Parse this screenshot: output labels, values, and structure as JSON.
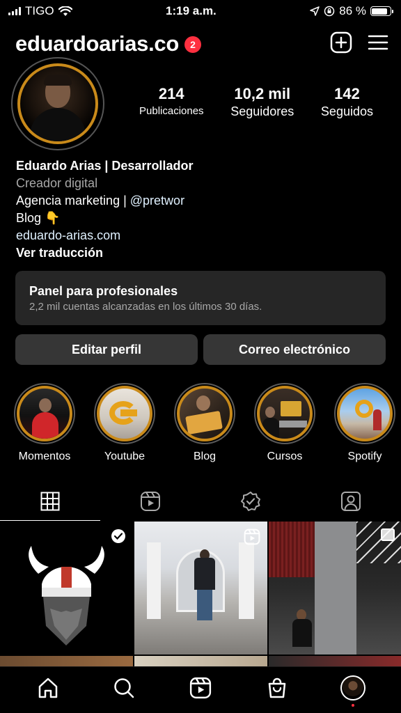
{
  "status_bar": {
    "carrier": "TIGO",
    "time": "1:19 a.m.",
    "battery": "86 %",
    "battery_level": 0.86
  },
  "header": {
    "username": "eduardoarias.co",
    "notification_count": "2",
    "new_post_icon": "plus-square-icon",
    "menu_icon": "hamburger-menu-icon"
  },
  "stats": [
    {
      "value": "214",
      "label": "Publicaciones"
    },
    {
      "value": "10,2 mil",
      "label": "Seguidores"
    },
    {
      "value": "142",
      "label": "Seguidos"
    }
  ],
  "bio": {
    "name": "Eduardo Arias | Desarrollador",
    "category": "Creador digital",
    "line1_text": "Agencia marketing | ",
    "line1_mention": "@pretwor",
    "line2": "Blog 👇",
    "link": "eduardo-arias.com",
    "translate": "Ver traducción"
  },
  "dashboard": {
    "title": "Panel para profesionales",
    "subtitle": "2,2 mil cuentas alcanzadas en los últimos 30 días."
  },
  "buttons": {
    "edit": "Editar perfil",
    "email": "Correo electrónico"
  },
  "highlights": [
    {
      "label": "Momentos"
    },
    {
      "label": "Youtube"
    },
    {
      "label": "Blog"
    },
    {
      "label": "Cursos"
    },
    {
      "label": "Spotify"
    }
  ],
  "tabs": [
    "grid-icon",
    "reels-icon",
    "tagged-check-icon",
    "tagged-person-icon"
  ],
  "colors": {
    "accent_gold": "#c98a1a",
    "badge_red": "#ff3040",
    "surface": "#262626",
    "button": "#363636"
  },
  "tabbar": [
    "home-icon",
    "search-icon",
    "reels-icon",
    "shop-icon",
    "profile-avatar"
  ]
}
